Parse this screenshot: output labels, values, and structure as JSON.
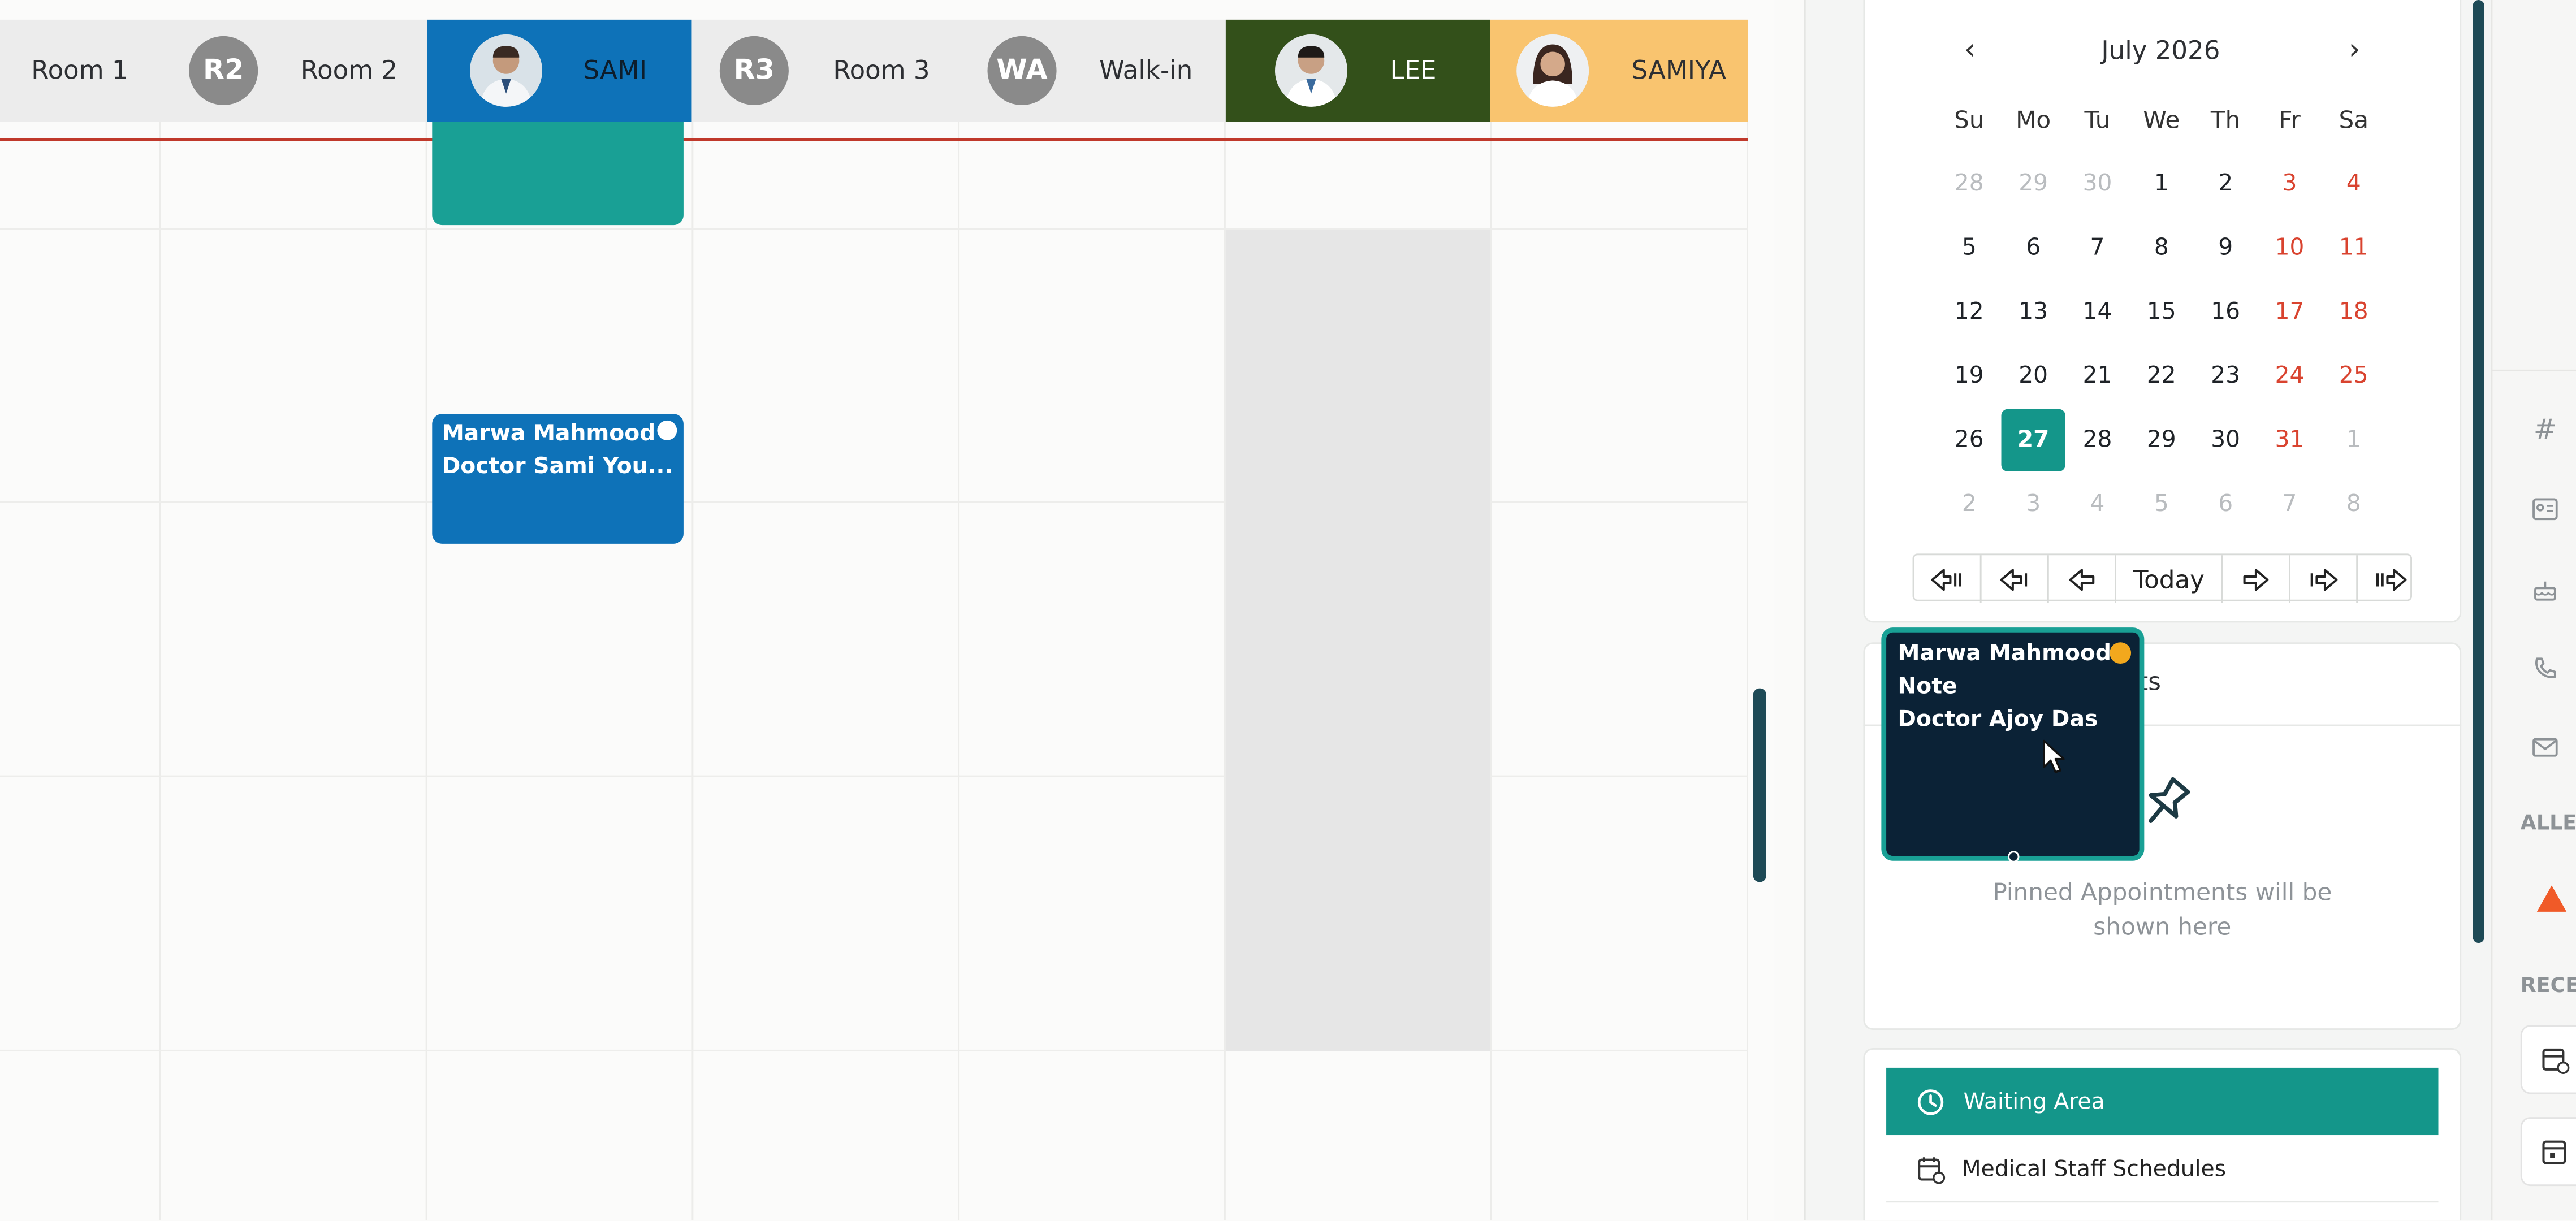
{
  "columns": [
    {
      "label": "Room 1",
      "initials": "",
      "color": "#ececec"
    },
    {
      "label": "Room 2",
      "initials": "R2",
      "color": "#ececec"
    },
    {
      "label": "SAMI",
      "initials": "",
      "color": "#0e72b8"
    },
    {
      "label": "Room 3",
      "initials": "R3",
      "color": "#ececec"
    },
    {
      "label": "Walk-in",
      "initials": "WA",
      "color": "#ececec"
    },
    {
      "label": "LEE",
      "initials": "",
      "color": "#33501a"
    },
    {
      "label": "SAMIYA",
      "initials": "",
      "color": "#f9c46f"
    }
  ],
  "events": [
    {
      "line1": "",
      "line2": "",
      "color": "#19a095"
    },
    {
      "line1": "Marwa Mahmood",
      "line2": "Doctor Sami You...",
      "color": "#0e72b8"
    }
  ],
  "minicalendar": {
    "month": "July 2026",
    "prev_icon": "chevron-left-icon",
    "next_icon": "chevron-right-icon",
    "weekdays": [
      "Su",
      "Mo",
      "Tu",
      "We",
      "Th",
      "Fr",
      "Sa"
    ],
    "weeks": [
      [
        "28",
        "29",
        "30",
        "1",
        "2",
        "3",
        "4"
      ],
      [
        "5",
        "6",
        "7",
        "8",
        "9",
        "10",
        "11"
      ],
      [
        "12",
        "13",
        "14",
        "15",
        "16",
        "17",
        "18"
      ],
      [
        "19",
        "20",
        "21",
        "22",
        "23",
        "24",
        "25"
      ],
      [
        "26",
        "27",
        "28",
        "29",
        "30",
        "31",
        "1"
      ],
      [
        "2",
        "3",
        "4",
        "5",
        "6",
        "7",
        "8"
      ]
    ],
    "selected_day": "27",
    "weekend_color": "#d9432f",
    "accent": "#14968a"
  },
  "nav": {
    "today_label": "Today",
    "buttons": [
      "first-icon",
      "prev-week-icon",
      "prev-day-icon",
      "next-day-icon",
      "next-week-icon",
      "last-icon"
    ]
  },
  "pinned": {
    "title_partial": "nts",
    "empty_text": "Pinned Appointments will be shown here"
  },
  "drag_card": {
    "line1": "Marwa Mahmood",
    "line2": "Note",
    "line3": "Doctor Ajoy Das",
    "status_color": "#f2a81d",
    "bg": "#0b2236"
  },
  "side_buttons": {
    "waiting_area": "Waiting Area",
    "medical_staff": "Medical Staff Schedules"
  },
  "strip": {
    "hash": "#",
    "allergies_label": "ALLE",
    "recent_label": "RECE"
  }
}
